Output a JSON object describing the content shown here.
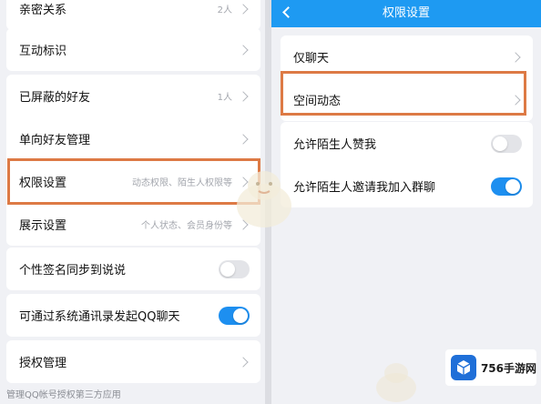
{
  "left": {
    "top_item": {
      "label": "亲密关系",
      "value": "2人"
    },
    "interaction": {
      "label": "互动标识"
    },
    "friends_group": [
      {
        "label": "已屏蔽的好友",
        "value": "1人"
      },
      {
        "label": "单向好友管理",
        "value": ""
      },
      {
        "label": "权限设置",
        "value": "动态权限、陌生人权限等"
      },
      {
        "label": "展示设置",
        "value": "个人状态、会员身份等"
      }
    ],
    "signature_sync": {
      "label": "个性签名同步到说说",
      "toggle": false
    },
    "contacts_chat": {
      "label": "可通过系统通讯录发起QQ聊天",
      "toggle": true
    },
    "auth": {
      "label": "授权管理"
    },
    "footer_text": "管理QQ帐号授权第三方应用"
  },
  "right": {
    "title": "权限设置",
    "items": [
      {
        "label": "仅聊天"
      },
      {
        "label": "空间动态"
      }
    ],
    "toggles": [
      {
        "label": "允许陌生人赞我",
        "on": false
      },
      {
        "label": "允许陌生人邀请我加入群聊",
        "on": true
      }
    ]
  },
  "watermark": {
    "text": "756手游网"
  },
  "colors": {
    "accent": "#1d8ff0",
    "header": "#1e9af2",
    "highlight": "#dd7a45",
    "toggle_off": "#e3e4e8"
  },
  "icons": [
    "chevron-right-icon",
    "back-arrow-icon",
    "cube-logo-icon"
  ]
}
